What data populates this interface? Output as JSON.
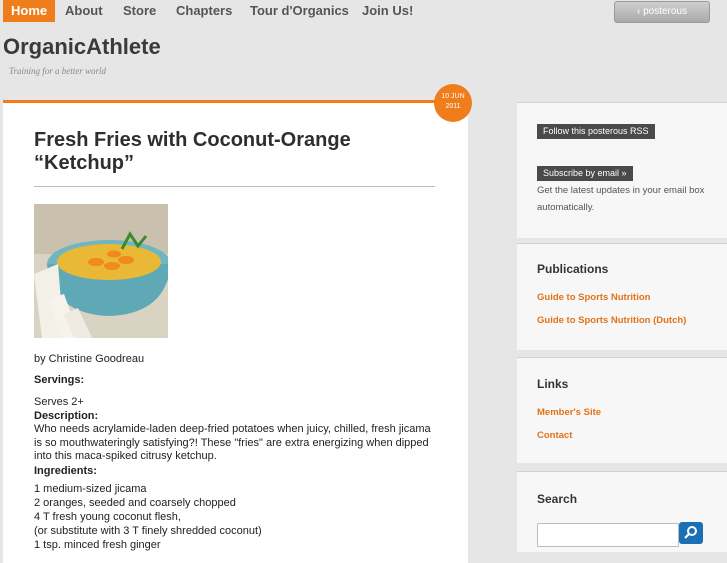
{
  "nav": {
    "items": [
      "Home",
      "About",
      "Store",
      "Chapters",
      "Tour d'Organics",
      "Join Us!"
    ],
    "posterous_label": "posterous"
  },
  "site": {
    "title": "OrganicAthlete",
    "tagline": "Training for a better world"
  },
  "post": {
    "date_day": "10 JUN",
    "date_year": "2011",
    "title": "Fresh Fries with Coconut-Orange “Ketchup”",
    "author": "by Christine Goodreau",
    "servings_label": "Servings:",
    "servings": "Serves 2+",
    "description_label": "Description:",
    "description": "Who needs acrylamide-laden deep-fried potatoes when juicy, chilled, fresh jicama is so mouthwateringly satisfying?! These \"fries\" are extra energizing when dipped into this maca-spiked citrusy ketchup.",
    "ingredients_label": "Ingredients:",
    "ingredients": [
      "1 medium-sized jicama",
      "2 oranges, seeded and coarsely chopped",
      "4 T fresh young coconut flesh,",
      "(or substitute with 3 T finely shredded coconut)",
      "1 tsp. minced fresh ginger"
    ]
  },
  "sidebar": {
    "follow_label": "Follow this posterous RSS",
    "subscribe_label": "Subscribe by email »",
    "subscribe_text": "Get the latest updates in your email box automatically.",
    "publications_heading": "Publications",
    "publications": [
      "Guide to Sports Nutrition",
      "Guide to Sports Nutrition (Dutch)"
    ],
    "links_heading": "Links",
    "links": [
      "Member's Site",
      "Contact"
    ],
    "search_heading": "Search",
    "search_placeholder": ""
  },
  "colors": {
    "accent": "#f07d1b",
    "search_button": "#1a6fb5"
  }
}
